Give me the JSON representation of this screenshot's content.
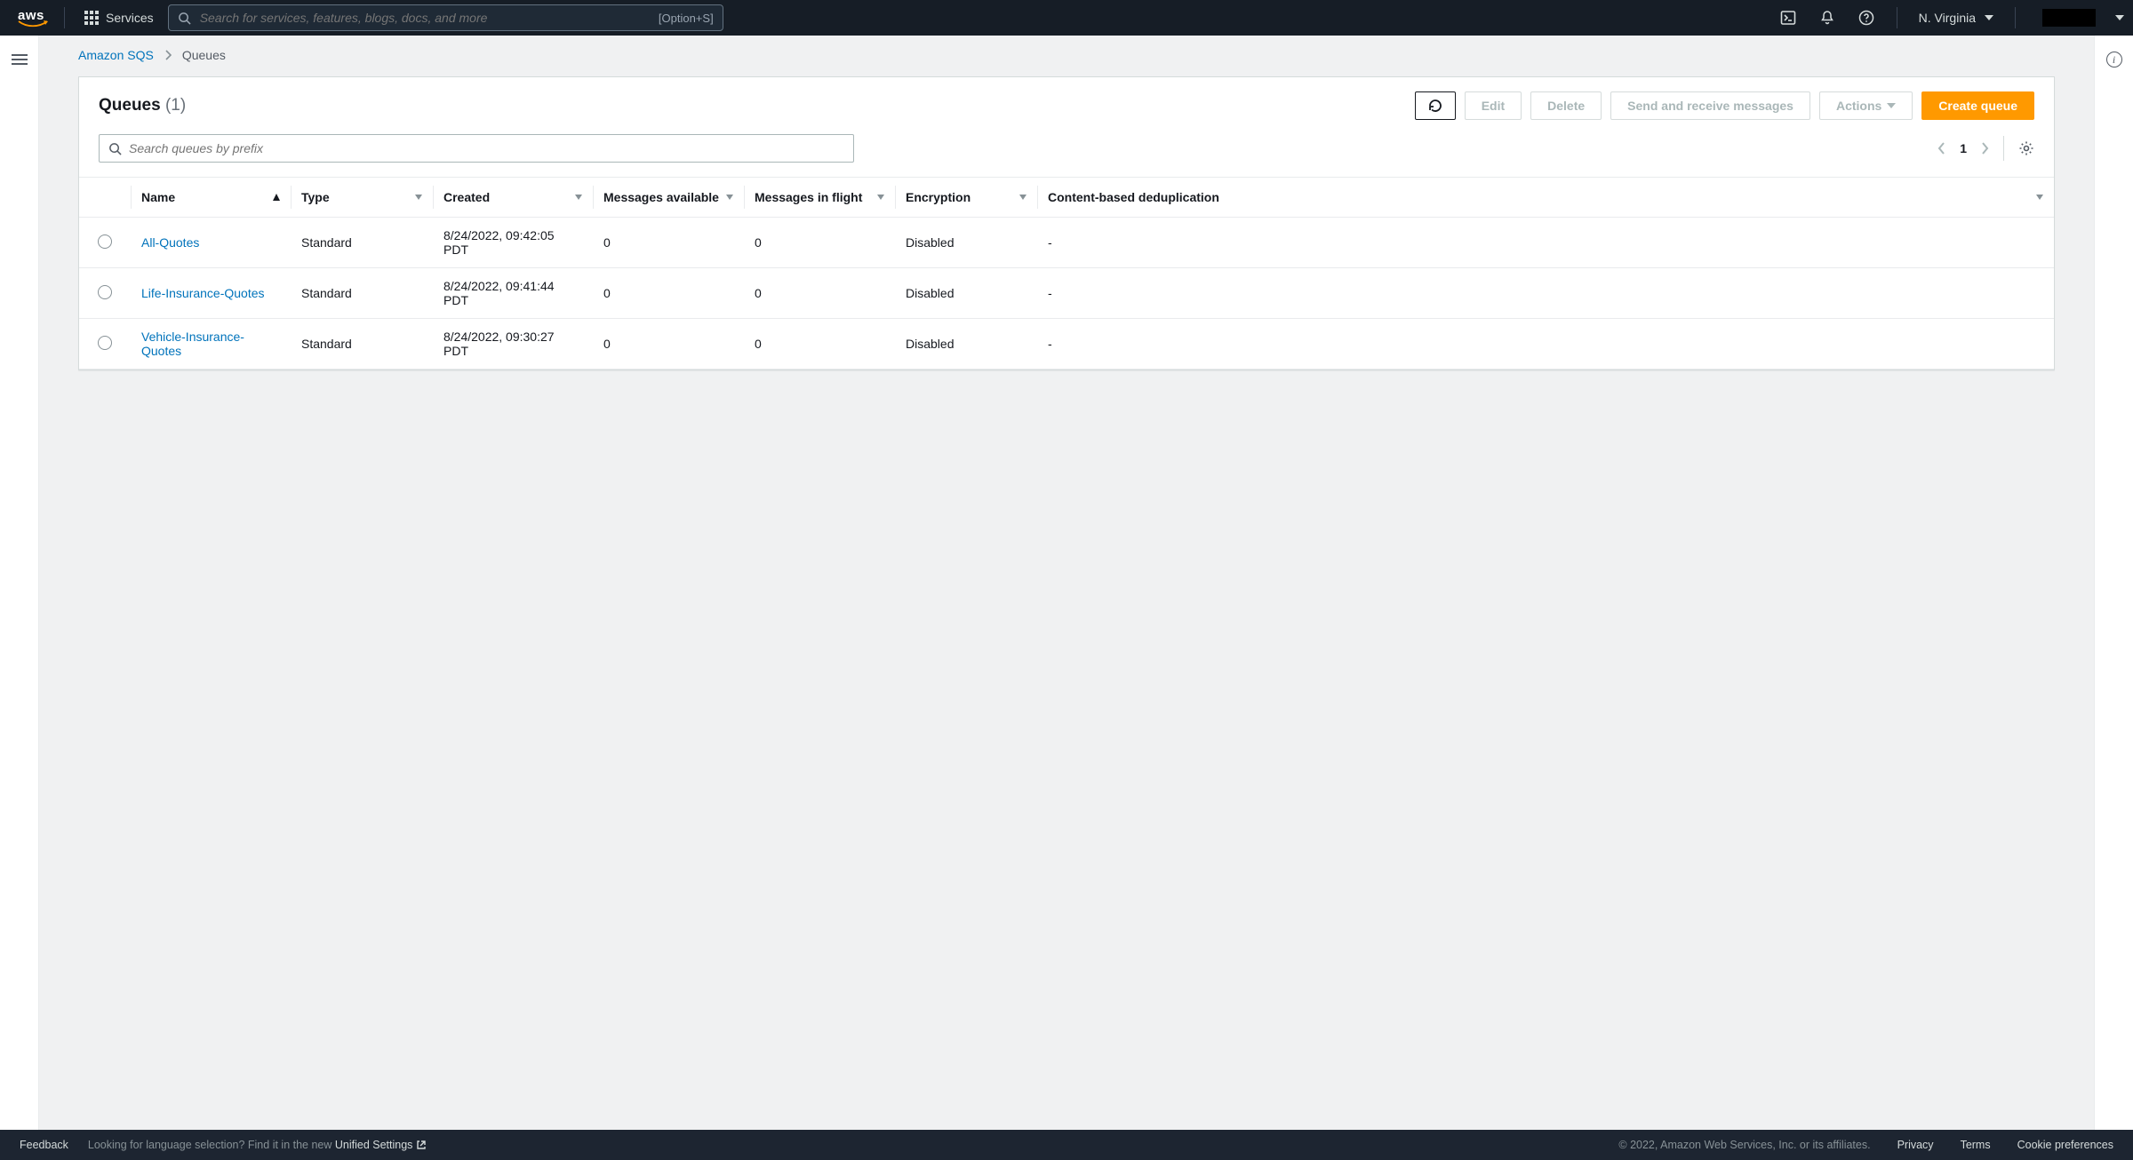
{
  "topnav": {
    "services_label": "Services",
    "search_placeholder": "Search for services, features, blogs, docs, and more",
    "search_shortcut": "[Option+S]",
    "region": "N. Virginia"
  },
  "breadcrumbs": {
    "root": "Amazon SQS",
    "current": "Queues"
  },
  "panel": {
    "title": "Queues",
    "count_display": "(1)",
    "buttons": {
      "edit": "Edit",
      "delete": "Delete",
      "send_receive": "Send and receive messages",
      "actions": "Actions",
      "create": "Create queue"
    },
    "search_placeholder": "Search queues by prefix",
    "page": "1"
  },
  "table": {
    "columns": {
      "name": "Name",
      "type": "Type",
      "created": "Created",
      "msgs_avail": "Messages available",
      "msgs_flight": "Messages in flight",
      "encryption": "Encryption",
      "dedup": "Content-based deduplication"
    },
    "rows": [
      {
        "name": "All-Quotes",
        "type": "Standard",
        "created": "8/24/2022, 09:42:05 PDT",
        "avail": "0",
        "flight": "0",
        "encryption": "Disabled",
        "dedup": "-"
      },
      {
        "name": "Life-Insurance-Quotes",
        "type": "Standard",
        "created": "8/24/2022, 09:41:44 PDT",
        "avail": "0",
        "flight": "0",
        "encryption": "Disabled",
        "dedup": "-"
      },
      {
        "name": "Vehicle-Insurance-Quotes",
        "type": "Standard",
        "created": "8/24/2022, 09:30:27 PDT",
        "avail": "0",
        "flight": "0",
        "encryption": "Disabled",
        "dedup": "-"
      }
    ]
  },
  "footer": {
    "feedback": "Feedback",
    "lang_prompt": "Looking for language selection? Find it in the new ",
    "unified": "Unified Settings",
    "copyright": "© 2022, Amazon Web Services, Inc. or its affiliates.",
    "privacy": "Privacy",
    "terms": "Terms",
    "cookies": "Cookie preferences"
  }
}
